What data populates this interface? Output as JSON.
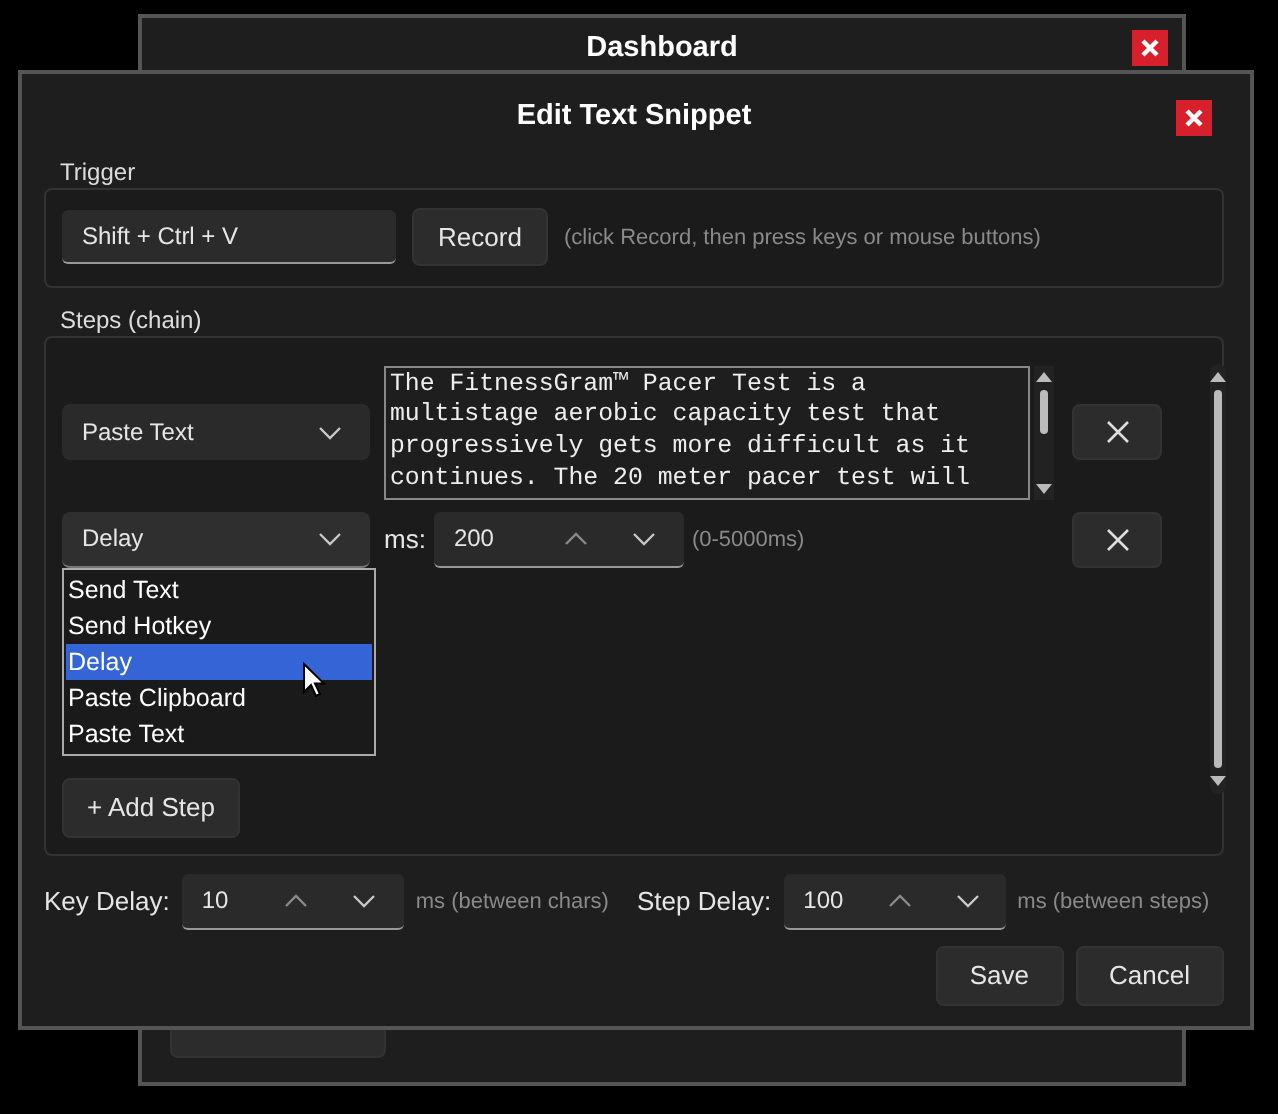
{
  "background_window": {
    "title": "Dashboard"
  },
  "dialog": {
    "title": "Edit Text Snippet"
  },
  "trigger": {
    "label": "Trigger",
    "value": "Shift + Ctrl + V",
    "record_button": "Record",
    "hint": "(click Record, then press keys or mouse buttons)"
  },
  "steps": {
    "label": "Steps (chain)",
    "items": [
      {
        "kind": "text",
        "type": "Paste Text",
        "text": "The FitnessGram™ Pacer Test is a multistage aerobic capacity test that progressively gets more difficult as it continues. The 20 meter pacer test will"
      },
      {
        "kind": "delay",
        "type": "Delay",
        "ms_label": "ms:",
        "value": "200",
        "hint": "(0-5000ms)",
        "expanded": true
      }
    ],
    "dropdown_options": [
      {
        "label": "Send Text",
        "selected": false
      },
      {
        "label": "Send Hotkey",
        "selected": false
      },
      {
        "label": "Delay",
        "selected": true
      },
      {
        "label": "Paste Clipboard",
        "selected": false
      },
      {
        "label": "Paste Text",
        "selected": false
      }
    ],
    "add_button": "+ Add Step"
  },
  "key_delay": {
    "label": "Key Delay:",
    "value": "10",
    "hint": "ms (between chars)"
  },
  "step_delay": {
    "label": "Step Delay:",
    "value": "100",
    "hint": "ms (between steps)"
  },
  "buttons": [
    "Save",
    "Cancel"
  ]
}
